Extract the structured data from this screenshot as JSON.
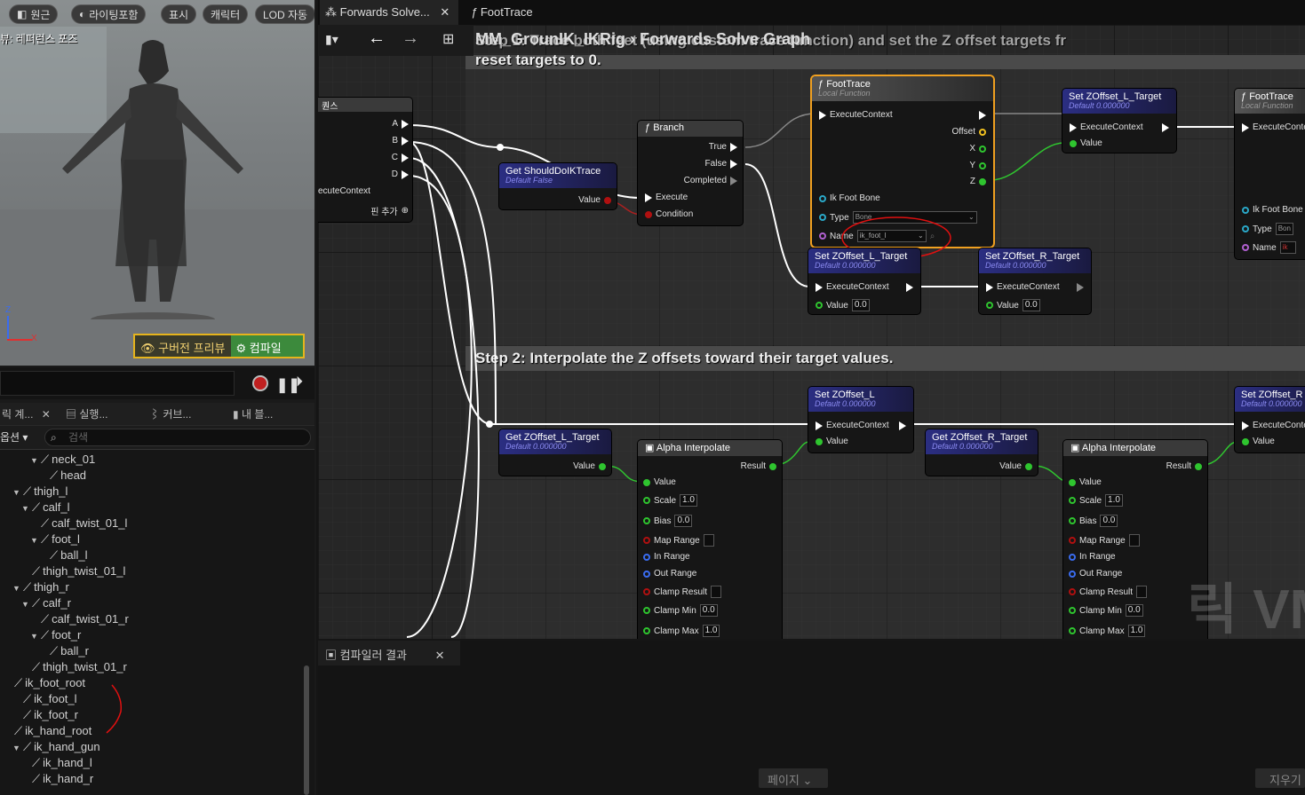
{
  "viewport": {
    "buttons": [
      "원근",
      "라이팅포함",
      "표시",
      "캐릭터",
      "LOD 자동"
    ],
    "preview_label": "뷰: 레퍼런스 포즈",
    "axis_z": "Z",
    "axis_x": "X",
    "old_preview": "구버전 프리뷰",
    "compile": "컴파일"
  },
  "panel_tabs": [
    "릭 계...",
    "실행...",
    "커브...",
    "내 블..."
  ],
  "options_label": "옵션",
  "search_placeholder": "검색",
  "tree": [
    {
      "label": "neck_01",
      "depth": 2,
      "arrow": true
    },
    {
      "label": "head",
      "depth": 3,
      "arrow": false
    },
    {
      "label": "thigh_l",
      "depth": 0,
      "arrow": true
    },
    {
      "label": "calf_l",
      "depth": 1,
      "arrow": true
    },
    {
      "label": "calf_twist_01_l",
      "depth": 2,
      "arrow": false
    },
    {
      "label": "foot_l",
      "depth": 2,
      "arrow": true
    },
    {
      "label": "ball_l",
      "depth": 3,
      "arrow": false
    },
    {
      "label": "thigh_twist_01_l",
      "depth": 1,
      "arrow": false
    },
    {
      "label": "thigh_r",
      "depth": 0,
      "arrow": true
    },
    {
      "label": "calf_r",
      "depth": 1,
      "arrow": true
    },
    {
      "label": "calf_twist_01_r",
      "depth": 2,
      "arrow": false
    },
    {
      "label": "foot_r",
      "depth": 2,
      "arrow": true
    },
    {
      "label": "ball_r",
      "depth": 3,
      "arrow": false
    },
    {
      "label": "thigh_twist_01_r",
      "depth": 1,
      "arrow": false
    },
    {
      "label": "ik_foot_root",
      "depth": -1,
      "arrow": false
    },
    {
      "label": "ik_foot_l",
      "depth": 0,
      "arrow": false
    },
    {
      "label": "ik_foot_r",
      "depth": 0,
      "arrow": false
    },
    {
      "label": "ik_hand_root",
      "depth": -1,
      "arrow": false
    },
    {
      "label": "ik_hand_gun",
      "depth": 0,
      "arrow": true
    },
    {
      "label": "ik_hand_l",
      "depth": 1,
      "arrow": false
    },
    {
      "label": "ik_hand_r",
      "depth": 1,
      "arrow": false
    }
  ],
  "tabs": {
    "forwards": "Forwards Solve...",
    "foottrace": "FootTrace"
  },
  "breadcrumb": {
    "asset": "MM_GrounIK_IKRig",
    "graph": "Forwards Solve Graph"
  },
  "comment1": "Step 1: Trace both feet (using custom trace function) and set the Z offset targets fr",
  "comment1_line2": "reset targets to 0.",
  "comment2": "Step 2: Interpolate the Z offsets toward their target values.",
  "sequence": {
    "title": "퀀스",
    "pins": [
      "A",
      "B",
      "C",
      "D"
    ],
    "exec_in": "ecuteContext",
    "add_pin": "핀 추가"
  },
  "get_should": {
    "title": "Get ShouldDoIKTrace",
    "sub": "Default False",
    "pin": "Value"
  },
  "branch": {
    "title": "Branch",
    "outs": [
      "True",
      "False",
      "Completed"
    ],
    "ins": [
      "Execute",
      "Condition"
    ]
  },
  "foottrace1": {
    "title": "FootTrace",
    "sub": "Local Function",
    "exec": "ExecuteContext",
    "offset": "Offset",
    "xyz": [
      "X",
      "Y",
      "Z"
    ],
    "bone": "Ik Foot Bone",
    "type_label": "Type",
    "type_val": "Bone",
    "name_label": "Name",
    "name_val": "ik_foot_l"
  },
  "foottrace2": {
    "title": "FootTrace",
    "sub": "Local Function",
    "exec": "ExecuteConte",
    "bone": "Ik Foot Bone",
    "type_label": "Type",
    "type_val": "Bon",
    "name_label": "Name",
    "name_val": "ik"
  },
  "setL_target_top": {
    "title": "Set ZOffset_L_Target",
    "sub": "Default 0.000000",
    "exec": "ExecuteContext",
    "value": "Value"
  },
  "setL_target_low": {
    "title": "Set ZOffset_L_Target",
    "sub": "Default 0.000000",
    "exec": "ExecuteContext",
    "value": "Value",
    "val": "0.0"
  },
  "setR_target_low": {
    "title": "Set ZOffset_R_Target",
    "sub": "Default 0.000000",
    "exec": "ExecuteContext",
    "value": "Value",
    "val": "0.0"
  },
  "getL_target": {
    "title": "Get ZOffset_L_Target",
    "sub": "Default 0.000000",
    "pin": "Value"
  },
  "getR_target": {
    "title": "Get ZOffset_R_Target",
    "sub": "Default 0.000000",
    "pin": "Value"
  },
  "setL": {
    "title": "Set ZOffset_L",
    "sub": "Default 0.000000",
    "exec": "ExecuteContext",
    "value": "Value"
  },
  "setR": {
    "title": "Set ZOffset_R",
    "sub": "Default 0.000000",
    "exec": "ExecuteConte",
    "value": "Value"
  },
  "alpha": {
    "title": "Alpha Interpolate",
    "result": "Result",
    "value": "Value",
    "scale": "Scale",
    "scale_v": "1.0",
    "bias": "Bias",
    "bias_v": "0.0",
    "maprange": "Map Range",
    "inrange": "In Range",
    "outrange": "Out Range",
    "clampres": "Clamp Result",
    "clampmin": "Clamp Min",
    "clampmin_v": "0.0",
    "clampmax": "Clamp Max",
    "clampmax_v": "1.0"
  },
  "watermark": "릭 VM",
  "bottom_tab": "컴파일러 결과",
  "page_btn": "페이지",
  "clear_btn": "지우기"
}
